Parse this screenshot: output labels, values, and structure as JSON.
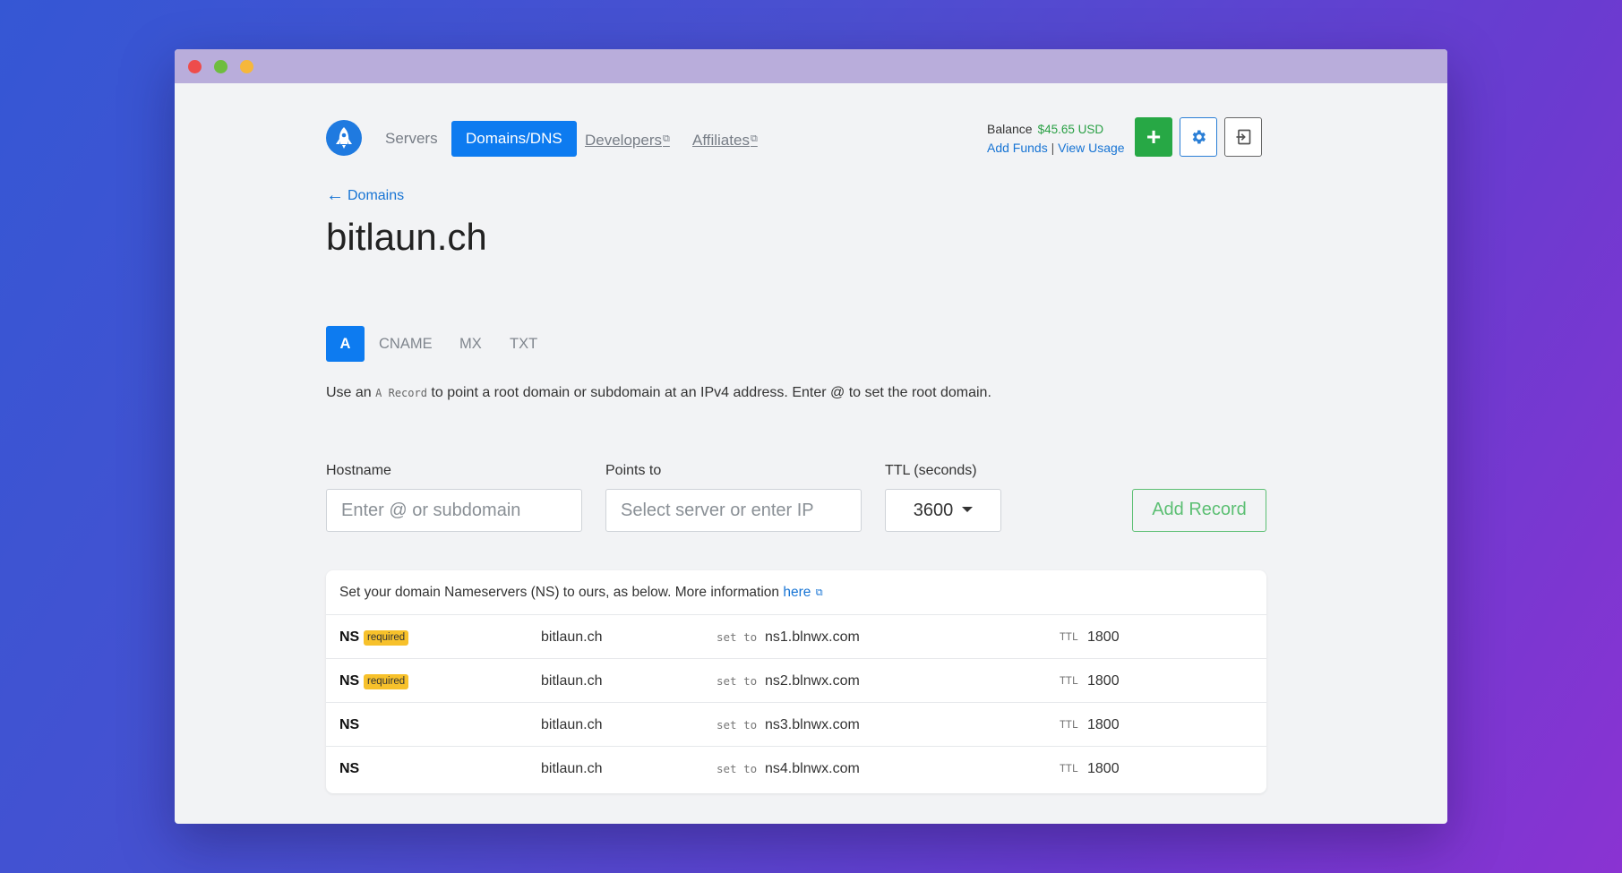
{
  "nav": {
    "servers": "Servers",
    "domains_dns": "Domains/DNS",
    "developers": "Developers",
    "affiliates": "Affiliates"
  },
  "balance": {
    "label": "Balance",
    "amount": "$45.65 USD",
    "add_funds": "Add Funds",
    "separator": "|",
    "view_usage": "View Usage"
  },
  "back_link": "Domains",
  "page_title": "bitlaun.ch",
  "tabs": [
    "A",
    "CNAME",
    "MX",
    "TXT"
  ],
  "description": {
    "prefix": "Use an",
    "code": "A Record",
    "suffix": "to point a root domain or subdomain at an IPv4 address. Enter @ to set the root domain."
  },
  "form": {
    "hostname_label": "Hostname",
    "hostname_placeholder": "Enter @ or subdomain",
    "points_to_label": "Points to",
    "points_to_placeholder": "Select server or enter IP",
    "ttl_label": "TTL (seconds)",
    "ttl_value": "3600",
    "add_button": "Add Record"
  },
  "nameservers": {
    "header_text": "Set your domain Nameservers (NS) to ours, as below. More information",
    "header_link": "here",
    "set_to": "set to",
    "ttl_key": "TTL",
    "rows": [
      {
        "type": "NS",
        "badge": "required",
        "host": "bitlaun.ch",
        "value": "ns1.blnwx.com",
        "ttl": "1800"
      },
      {
        "type": "NS",
        "badge": "required",
        "host": "bitlaun.ch",
        "value": "ns2.blnwx.com",
        "ttl": "1800"
      },
      {
        "type": "NS",
        "badge": "",
        "host": "bitlaun.ch",
        "value": "ns3.blnwx.com",
        "ttl": "1800"
      },
      {
        "type": "NS",
        "badge": "",
        "host": "bitlaun.ch",
        "value": "ns4.blnwx.com",
        "ttl": "1800"
      }
    ]
  },
  "colors": {
    "primary": "#0d7bf0",
    "success": "#27a845",
    "badge": "#f7c12b",
    "link": "#1774d4"
  },
  "icons": {
    "logo": "rocket-icon",
    "add": "plus-icon",
    "settings": "gear-icon",
    "logout": "exit-icon",
    "back": "arrow-left-icon",
    "external": "external-link-icon"
  }
}
